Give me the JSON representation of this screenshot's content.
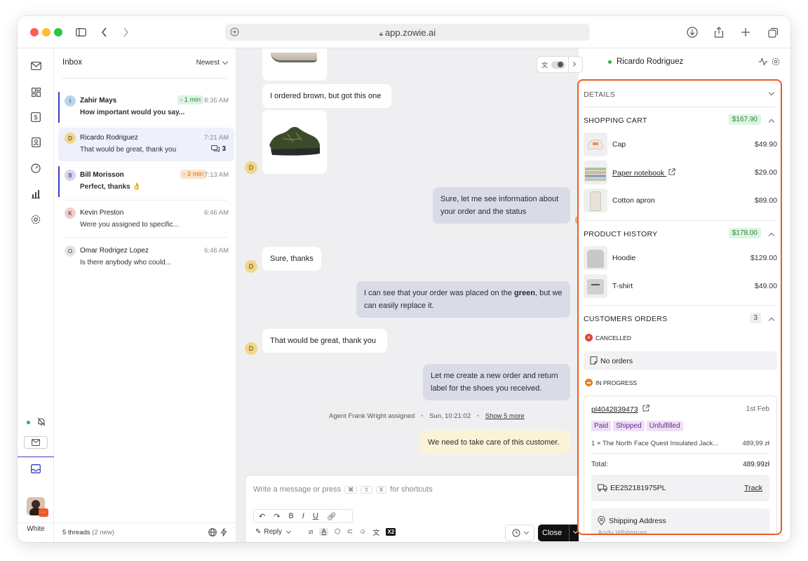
{
  "browser": {
    "url": "app.zowie.ai"
  },
  "rail": {
    "bottom_label": "White"
  },
  "inbox": {
    "title": "Inbox",
    "sort": "Newest",
    "threads": [
      {
        "initial": "I",
        "name": "Zahir Mays",
        "preview": "How important would you say...",
        "time": "8:35 AM",
        "badge": "- 1 min",
        "unread": true
      },
      {
        "initial": "D",
        "name": "Ricardo Rodriguez",
        "preview": "That would be great, thank you",
        "time": "7:21 AM",
        "count": "3",
        "selected": true
      },
      {
        "initial": "B",
        "name": "Bill Morisson",
        "preview": "Perfect, thanks 👌",
        "time": "7:13 AM",
        "badge": "- 3 min",
        "unread": true
      },
      {
        "initial": "K",
        "name": "Kevin Preston",
        "preview": "Were you assigned to specific...",
        "time": "6:46 AM"
      },
      {
        "initial": "O",
        "name": "Omar Rodrigez Lopez",
        "preview": "Is there anybody who could...",
        "time": "6:46 AM"
      }
    ],
    "footer": "5 threads",
    "footer_new": "(2 new)"
  },
  "chat": {
    "customer_initial": "D",
    "messages": [
      {
        "dir": "in",
        "text": "I ordered brown, but got this one"
      },
      {
        "dir": "out",
        "text": "Sure, let me see information about your order and the status"
      },
      {
        "dir": "in",
        "text": "Sure, thanks"
      },
      {
        "dir": "out",
        "text_a": "I can see that your order was placed on the ",
        "text_b": "green",
        "text_c": ", but we can easily replace it."
      },
      {
        "dir": "in",
        "text": "That would be great, thank you"
      },
      {
        "dir": "out",
        "text": "Let me create a new order and return label for the shoes you received."
      }
    ],
    "system": {
      "assigned": "Agent Frank Wright assigned",
      "time": "Sun, 10:21:02",
      "more": "Show 5 more"
    },
    "note": "We need to take care of this customer.",
    "composer": {
      "placeholder": "Write a message or press",
      "keys": [
        "⌘",
        "⇧",
        "X"
      ],
      "suffix": "for shortcuts",
      "reply_label": "Reply",
      "close_label": "Close",
      "x2": "X2"
    }
  },
  "customer": {
    "name": "Ricardo Rodriguez",
    "online_color": "#2bb24c",
    "details_label": "DETAILS",
    "cart": {
      "title": "SHOPPING CART",
      "total": "$167.90",
      "items": [
        {
          "name": "Cap",
          "price": "$49.90"
        },
        {
          "name": "Paper notebook",
          "price": "$29.00",
          "link": true
        },
        {
          "name": "Cotton apron",
          "price": "$89.00"
        }
      ]
    },
    "history": {
      "title": "PRODUCT HISTORY",
      "total": "$178.00",
      "items": [
        {
          "name": "Hoodie",
          "price": "$129.00"
        },
        {
          "name": "T-shirt",
          "price": "$49.00"
        }
      ]
    },
    "orders": {
      "title": "CUSTOMERS ORDERS",
      "count": "3",
      "cancelled_label": "CANCELLED",
      "no_orders": "No orders",
      "in_progress_label": "IN PROGRESS",
      "order": {
        "id": "pl4042839473",
        "date": "1st Feb",
        "tags": [
          "Paid",
          "Shipped",
          "Unfulfilled"
        ],
        "line": "1 × The North Face Quest Insulated Jack...",
        "line_price": "489,99 zł",
        "total_label": "Total:",
        "total": "489.99zł",
        "tracking": "EE252181975PL",
        "track_label": "Track",
        "shipping_label": "Shipping Address",
        "shipping_name": "Andy Whiteman"
      }
    }
  },
  "colors": {
    "accent": "#3b3fbf",
    "highlight_border": "#ef5a24",
    "price_green": "#2a8a3c"
  }
}
